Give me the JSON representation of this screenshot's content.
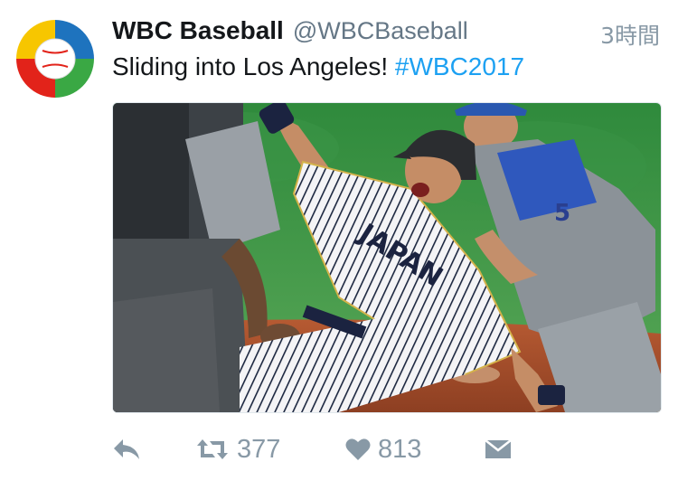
{
  "tweet": {
    "display_name": "WBC Baseball",
    "handle": "@WBCBaseball",
    "timestamp": "3時間",
    "text": "Sliding into Los Angeles! ",
    "hashtag": "#WBC2017",
    "photo": {
      "jersey_text": "JAPAN",
      "fielder_number": "5"
    }
  },
  "actions": {
    "reply_icon": "reply-icon",
    "retweet_icon": "retweet-icon",
    "retweet_count": "377",
    "like_icon": "heart-icon",
    "like_count": "813",
    "message_icon": "envelope-icon"
  },
  "colors": {
    "hashtag": "#1da1f2",
    "action_gray": "#8899a6",
    "name_black": "#14171a"
  }
}
